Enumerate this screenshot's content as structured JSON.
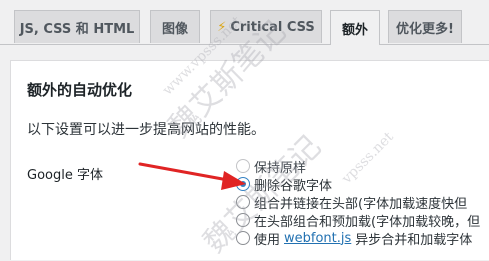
{
  "tabs": [
    {
      "label": "JS, CSS 和 HTML",
      "active": false
    },
    {
      "label": "图像",
      "active": false
    },
    {
      "label": "Critical CSS",
      "icon": "lightning-bolt-icon",
      "active": false
    },
    {
      "label": "额外",
      "active": true
    },
    {
      "label": "优化更多!",
      "active": false
    }
  ],
  "section": {
    "title": "额外的自动优化",
    "description": "以下设置可以进一步提高网站的性能。"
  },
  "google_fonts": {
    "label": "Google 字体",
    "options": [
      {
        "text": "保持原样",
        "checked": false
      },
      {
        "text": "删除谷歌字体",
        "checked": true
      },
      {
        "text": "组合并链接在头部(字体加载速度快但"
      },
      {
        "text": "在头部组合和预加载(字体加载较晚，但"
      },
      {
        "prefix": "使用",
        "link": "webfont.js",
        "suffix": "异步合并和加载字体"
      }
    ]
  },
  "annotation": {
    "arrow_color": "#e02424"
  },
  "watermark": {
    "main": "魏艾斯笔记",
    "url": "www.vpsss.net",
    "main2": "魏艾斯笔记",
    "url2": "vpsss.net"
  }
}
